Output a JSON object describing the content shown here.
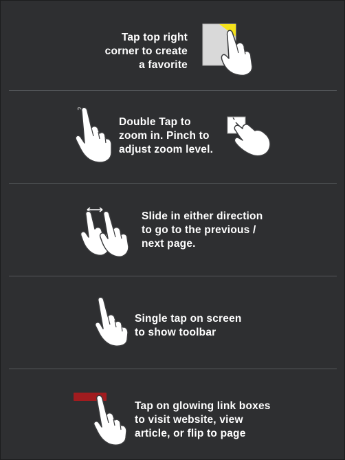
{
  "sections": [
    {
      "id": "favorite",
      "caption": "Tap top right\ncorner to create\na favorite",
      "icon": "tap-corner-icon"
    },
    {
      "id": "zoom",
      "caption": "Double Tap to\nzoom in.  Pinch to\nadjust zoom level.",
      "icon": "double-tap-icon"
    },
    {
      "id": "slide",
      "caption": "Slide in either direction\nto go to the previous /\nnext page.",
      "icon": "swipe-icon"
    },
    {
      "id": "toolbar",
      "caption": "Single tap on screen\nto show toolbar",
      "icon": "single-tap-icon"
    },
    {
      "id": "links",
      "caption": "Tap on glowing link boxes\nto visit website, view\narticle, or flip to page",
      "icon": "link-box-tap-icon"
    }
  ],
  "colors": {
    "background": "#2e2f31",
    "divider": "#55585b",
    "text": "#ffffff",
    "hand": "#ffffff",
    "favorite_corner": "#f5e21b",
    "link_box": "#a11c1f",
    "page_card": "#d9d9d9"
  }
}
